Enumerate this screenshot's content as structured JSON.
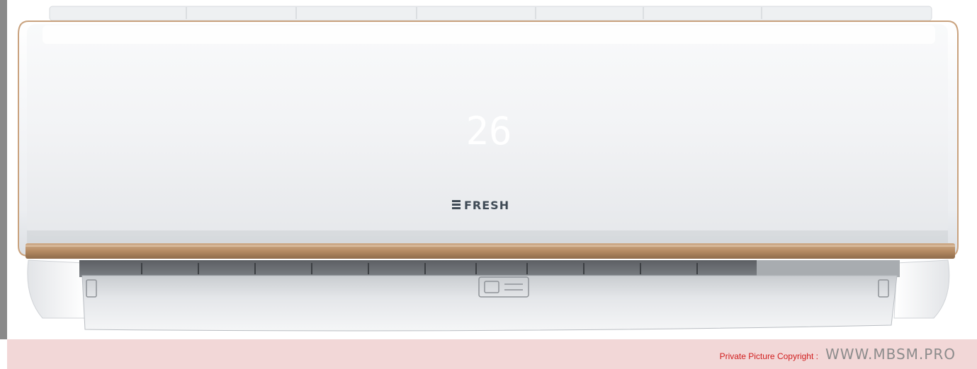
{
  "product": {
    "display_reading": "26",
    "brand": "FRESH"
  },
  "watermark": {
    "label": "Private Picture Copyright :",
    "site": "WWW.MBSM.PRO"
  },
  "colors": {
    "body": "#f3f4f6",
    "trim": "#b8906d",
    "footer_band": "#f2d7d7",
    "watermark_label": "#d11f1f",
    "watermark_site": "#8c8c8c"
  }
}
